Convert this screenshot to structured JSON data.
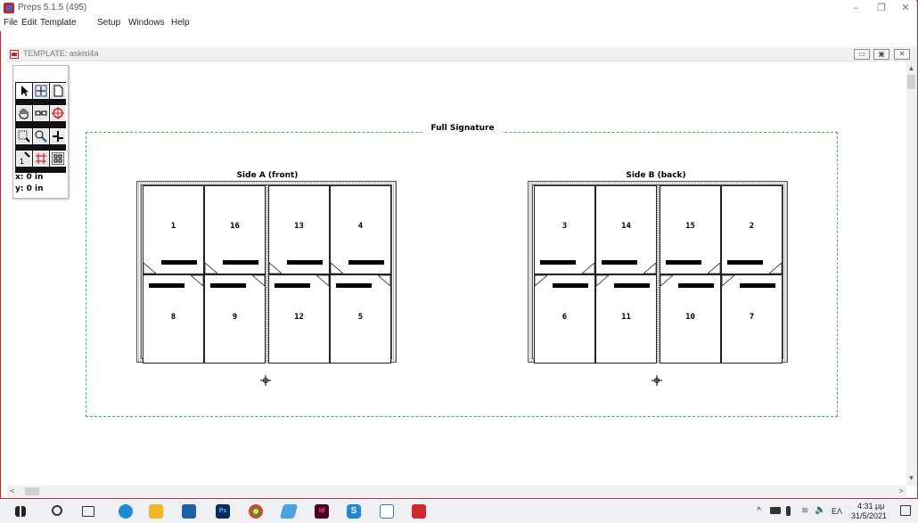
{
  "window": {
    "title": "Preps 5.1.5 (495)",
    "controls": {
      "minimize": "–",
      "restore": "❐",
      "close": "✕"
    }
  },
  "menu": [
    "File",
    "Edit",
    "Template",
    "Setup",
    "Windows",
    "Help"
  ],
  "child_window": {
    "title": "TEMPLATE: askisi4a",
    "controls": {
      "minimize": "▭",
      "restore": "▣",
      "close": "✕"
    }
  },
  "palette": {
    "tools": [
      "pointer-tool",
      "move-tool",
      "page-tool",
      "hand-tool",
      "link-tool",
      "target-tool",
      "zoom-tool",
      "find-tool",
      "corner-tool",
      "number-tool",
      "grid-tool",
      "signature-tool"
    ],
    "x_readout": "x: 0 in",
    "y_readout": "y: 0 in"
  },
  "layout": {
    "full_signature_label": "Full Signature",
    "sides": [
      {
        "label": "Side A (front)",
        "top_pages": [
          "1",
          "16",
          "13",
          "4"
        ],
        "bottom_pages": [
          "8",
          "9",
          "12",
          "5"
        ]
      },
      {
        "label": "Side B (back)",
        "top_pages": [
          "3",
          "14",
          "15",
          "2"
        ],
        "bottom_pages": [
          "6",
          "11",
          "10",
          "7"
        ]
      }
    ]
  },
  "taskbar": {
    "language": "EΛ",
    "time": "4:31 μμ",
    "date": "31/5/2021"
  },
  "colors": {
    "accent": "#c9252c",
    "signature_outline": "#3fb94a"
  }
}
